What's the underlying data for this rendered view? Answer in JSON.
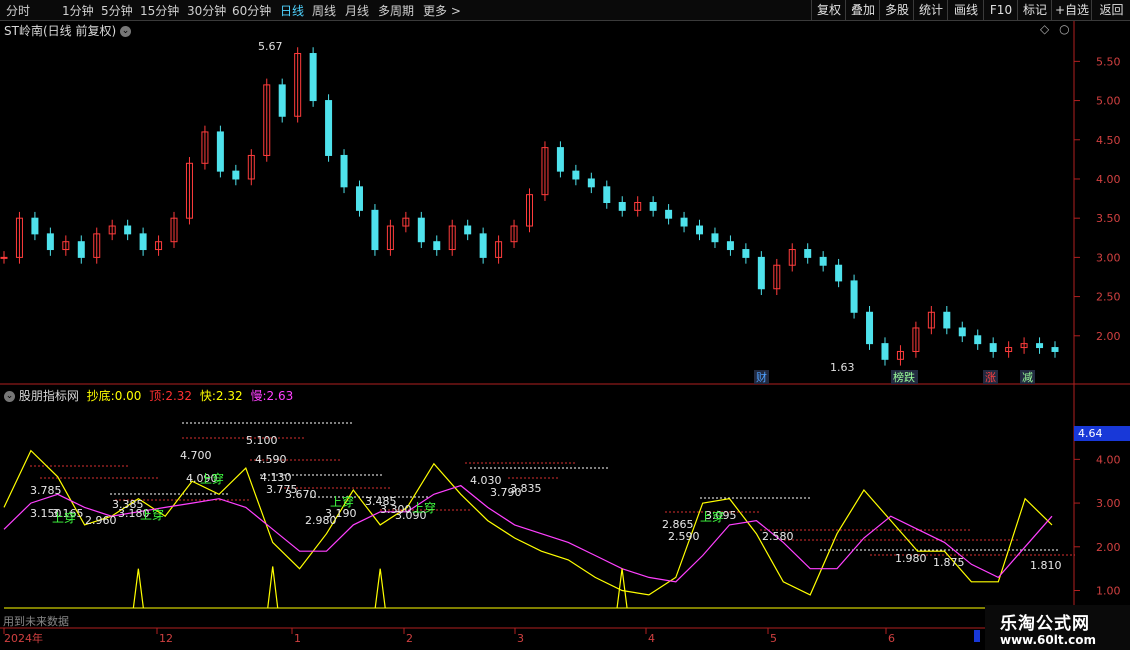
{
  "toolbar": {
    "periods": [
      "分时",
      "1分钟",
      "5分钟",
      "15分钟",
      "30分钟",
      "60分钟",
      "日线",
      "周线",
      "月线",
      "多周期",
      "更多 >"
    ],
    "active_period": "日线",
    "right_buttons": [
      "复权",
      "叠加",
      "多股",
      "统计",
      "画线",
      "F10",
      "标记",
      "+自选",
      "返回"
    ]
  },
  "price_panel": {
    "title": "ST岭南(日线 前复权)",
    "y_ticks": [
      "5.50",
      "5.00",
      "4.50",
      "4.00",
      "3.50",
      "3.00",
      "2.50",
      "2.00"
    ],
    "high_label": "5.67",
    "low_label": "1.63",
    "event_tags": [
      "财",
      "榜跌",
      "涨",
      "减"
    ]
  },
  "indicator_panel": {
    "name": "股朋指标网",
    "fields": [
      {
        "label": "抄底:",
        "value": "0.00",
        "color": "#ffff00"
      },
      {
        "label": "顶:",
        "value": "2.32",
        "color": "#ff3030"
      },
      {
        "label": "快:",
        "value": "2.32",
        "color": "#ffff00"
      },
      {
        "label": "慢:",
        "value": "2.63",
        "color": "#ff40ff"
      }
    ],
    "y_ticks": [
      "4.00",
      "3.00",
      "2.00",
      "1.00"
    ],
    "current_value": "4.64",
    "level_labels": [
      "5.100",
      "4.700",
      "4.590",
      "4.130",
      "4.090",
      "4.030",
      "3.835",
      "3.785",
      "3.790",
      "3.775",
      "3.670",
      "3.485",
      "3.385",
      "3.300",
      "3.190",
      "3.180",
      "3.165",
      "3.150",
      "3.095",
      "3.090",
      "2.980",
      "2.960",
      "2.865",
      "2.590",
      "2.580",
      "1.980",
      "1.875",
      "1.810"
    ],
    "signal_labels": [
      "上穿",
      "上穿",
      "上穿",
      "上穿",
      "上穿",
      "上穿"
    ],
    "footer_text": "用到未来数据"
  },
  "x_axis": {
    "labels": [
      "2024年",
      "12",
      "1",
      "2",
      "3",
      "4",
      "5",
      "6"
    ]
  },
  "chart_data": [
    {
      "type": "candlestick",
      "title": "ST岭南(日线 前复权)",
      "ylim": [
        1.5,
        5.9
      ],
      "y_ticks": [
        2.0,
        2.5,
        3.0,
        3.5,
        4.0,
        4.5,
        5.0,
        5.5
      ],
      "annotations": [
        {
          "text": "5.67",
          "type": "high"
        },
        {
          "text": "1.63",
          "type": "low"
        }
      ],
      "close_trend": [
        3.0,
        3.5,
        3.3,
        3.1,
        3.2,
        3.0,
        3.3,
        3.4,
        3.3,
        3.1,
        3.2,
        3.5,
        4.2,
        4.6,
        4.1,
        4.0,
        4.3,
        5.2,
        4.8,
        5.6,
        5.0,
        4.3,
        3.9,
        3.6,
        3.1,
        3.4,
        3.5,
        3.2,
        3.1,
        3.4,
        3.3,
        3.0,
        3.2,
        3.4,
        3.8,
        4.4,
        4.1,
        4.0,
        3.9,
        3.7,
        3.6,
        3.7,
        3.6,
        3.5,
        3.4,
        3.3,
        3.2,
        3.1,
        3.0,
        2.6,
        2.9,
        3.1,
        3.0,
        2.9,
        2.7,
        2.3,
        1.9,
        1.7,
        1.8,
        2.1,
        2.3,
        2.1,
        2.0,
        1.9,
        1.8,
        1.85,
        1.9,
        1.85,
        1.8
      ]
    },
    {
      "type": "line",
      "title": "股朋指标网",
      "ylim": [
        0.6,
        4.9
      ],
      "y_ticks": [
        1.0,
        2.0,
        3.0,
        4.0
      ],
      "series": [
        {
          "name": "快",
          "color": "#ffff00",
          "values": [
            2.9,
            4.2,
            3.6,
            2.5,
            2.7,
            3.1,
            2.7,
            3.5,
            3.2,
            3.8,
            2.1,
            1.5,
            2.3,
            3.3,
            2.5,
            2.9,
            3.9,
            3.2,
            2.6,
            2.2,
            1.9,
            1.7,
            1.3,
            1.0,
            0.9,
            1.3,
            3.0,
            3.1,
            2.3,
            1.2,
            0.9,
            2.3,
            3.3,
            2.6,
            1.9,
            1.9,
            1.2,
            1.2,
            3.1,
            2.5
          ]
        },
        {
          "name": "慢",
          "color": "#ff40ff",
          "values": [
            2.4,
            3.0,
            3.2,
            2.9,
            2.7,
            2.8,
            2.9,
            3.0,
            3.1,
            2.9,
            2.4,
            1.9,
            1.9,
            2.5,
            2.8,
            2.8,
            3.2,
            3.4,
            2.9,
            2.5,
            2.3,
            2.1,
            1.8,
            1.5,
            1.3,
            1.2,
            1.8,
            2.5,
            2.6,
            2.1,
            1.5,
            1.5,
            2.2,
            2.7,
            2.4,
            2.1,
            1.6,
            1.3,
            2.0,
            2.7
          ]
        },
        {
          "name": "抄底",
          "color": "#ffff00",
          "values": [
            0,
            0,
            0,
            0,
            0,
            0.9,
            0,
            0,
            0,
            0,
            0.95,
            0,
            0,
            0,
            0.9,
            0,
            0,
            0,
            0,
            0,
            0,
            0,
            0,
            0.9,
            0,
            0,
            0,
            0,
            0,
            0,
            0,
            0,
            0,
            0,
            0,
            0,
            0,
            0,
            0,
            0
          ]
        }
      ]
    }
  ]
}
